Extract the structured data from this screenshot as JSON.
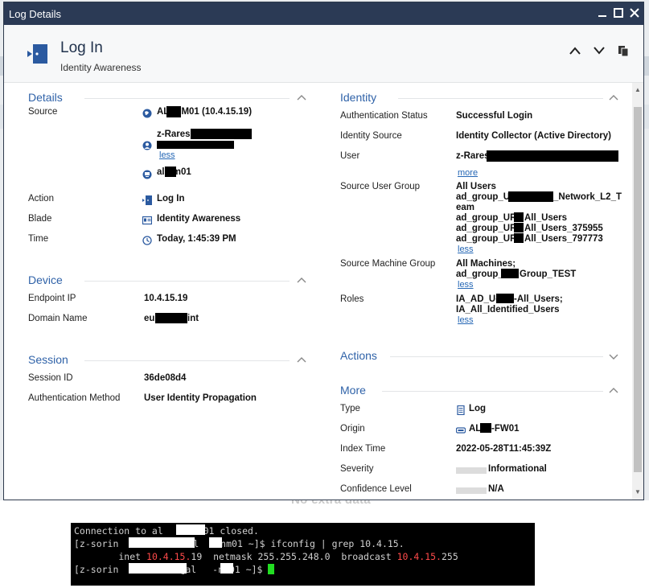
{
  "background": {
    "no_extra_data": "No extra data"
  },
  "window": {
    "title": "Log Details"
  },
  "header": {
    "title": "Log In",
    "subtitle": "Identity Awareness"
  },
  "details": {
    "section_title": "Details",
    "source_label": "Source",
    "source_value": "AL   -NM01 (10.4.15.19)",
    "user_value": "z-Rares (",
    "user_less": "less",
    "host_value": "al    nm01",
    "action_label": "Action",
    "action_value": "Log In",
    "blade_label": "Blade",
    "blade_value": "Identity Awareness",
    "time_label": "Time",
    "time_value": "Today, 1:45:39 PM"
  },
  "device": {
    "section_title": "Device",
    "endpoint_label": "Endpoint IP",
    "endpoint_value": "10.4.15.19",
    "domain_label": "Domain Name",
    "domain_value_prefix": "eu",
    "domain_value_suffix": "int"
  },
  "session": {
    "section_title": "Session",
    "id_label": "Session ID",
    "id_value": "36de08d4",
    "auth_method_label": "Authentication Method",
    "auth_method_value": "User Identity Propagation"
  },
  "identity": {
    "section_title": "Identity",
    "auth_status_label": "Authentication Status",
    "auth_status_value": "Successful Login",
    "id_source_label": "Identity Source",
    "id_source_value": "Identity Collector (Active Directory)",
    "user_label": "User",
    "user_value": "z-Rares",
    "user_more": "more",
    "sug_label": "Source User Group",
    "sug_lines": [
      "All Users",
      "ad_group_U",
      "_Network_L2_T",
      "eam",
      "ad_group_UR",
      "All_Users",
      "ad_group_UR",
      "All_Users_375955",
      "ad_group_UR",
      "All_Users_797773"
    ],
    "sug_less": "less",
    "smg_label": "Source Machine Group",
    "smg_line1": "All Machines;",
    "smg_line2a": "ad_group_",
    "smg_line2b": "Group_TEST",
    "smg_less": "less",
    "roles_label": "Roles",
    "roles_line1a": "IA_AD_U-",
    "roles_line1b": "-All_Users;",
    "roles_line2": "IA_All_Identified_Users",
    "roles_less": "less"
  },
  "actions": {
    "section_title": "Actions"
  },
  "more": {
    "section_title": "More",
    "type_label": "Type",
    "type_value": "Log",
    "origin_label": "Origin",
    "origin_value_a": "AL",
    "origin_value_b": "-FW01",
    "index_label": "Index Time",
    "index_value": "2022-05-28T11:45:39Z",
    "severity_label": "Severity",
    "severity_value": "Informational",
    "confidence_label": "Confidence Level",
    "confidence_value": "N/A"
  },
  "terminal": {
    "line1a": "Connection to al",
    "line1b": "fw01 closed.",
    "line2a": "[z-sorin",
    "line2b": "al",
    "line2c": "-nm01 ~]$ ifconfig | grep 10.4.15.",
    "line3a": "        inet ",
    "line3ip": "10.4.15.",
    "line3b": "19  netmask 255.255.248.0  broadcast ",
    "line3bc": "10.4.15.",
    "line3c": "255",
    "line4a": "[z-sorin",
    "line4b": "@al",
    "line4c": "-nm01 ~]$ "
  },
  "colors": {
    "titlebar": "#2b3a55",
    "accent": "#2f62a8",
    "link": "#2567b5",
    "terminal_red": "#ff4a4a",
    "cursor": "#22dd22"
  }
}
